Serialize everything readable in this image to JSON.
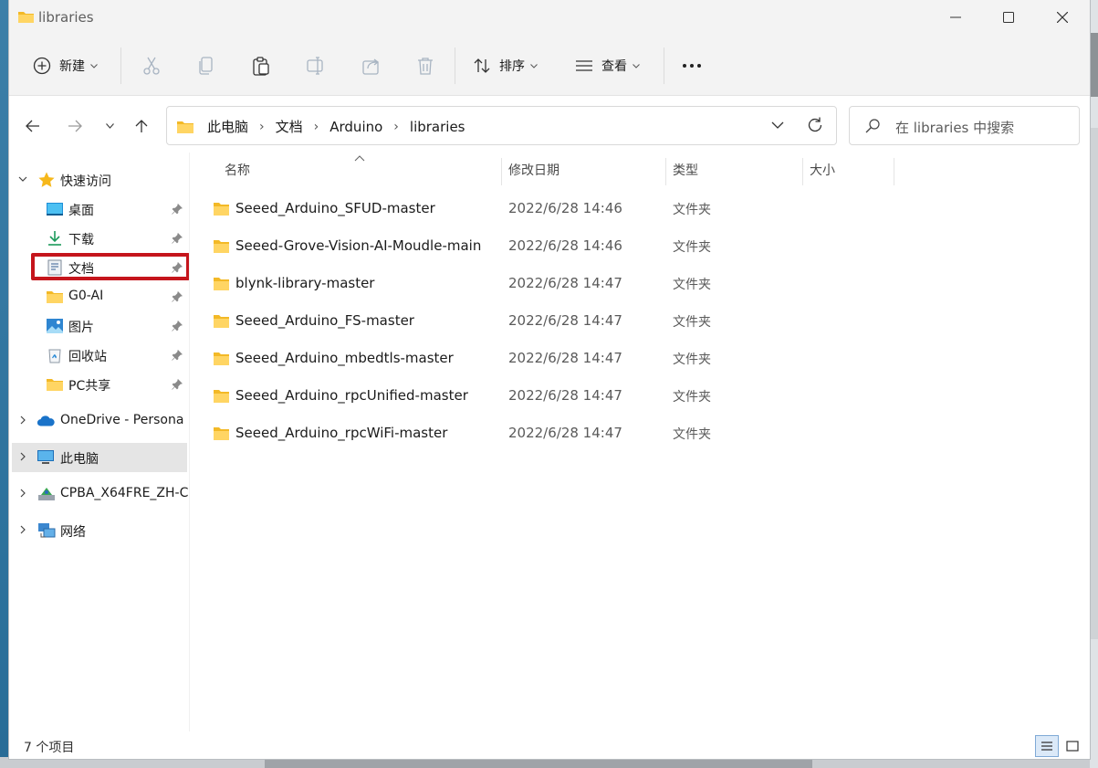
{
  "window": {
    "title": "libraries"
  },
  "toolbar": {
    "new_label": "新建",
    "sort_label": "排序",
    "view_label": "查看",
    "more_label": "···"
  },
  "address": {
    "crumbs": [
      "此电脑",
      "文档",
      "Arduino",
      "libraries"
    ]
  },
  "search": {
    "placeholder": "在 libraries 中搜索"
  },
  "sidebar": {
    "quick_access": "快速访问",
    "items": [
      {
        "label": "桌面",
        "icon": "desktop-icon"
      },
      {
        "label": "下载",
        "icon": "download-icon"
      },
      {
        "label": "文档",
        "icon": "documents-icon"
      },
      {
        "label": "G0-AI",
        "icon": "folder-icon"
      },
      {
        "label": "图片",
        "icon": "pictures-icon"
      },
      {
        "label": "回收站",
        "icon": "recycle-bin-icon"
      },
      {
        "label": "PC共享",
        "icon": "folder-icon"
      }
    ],
    "onedrive": "OneDrive - Persona",
    "this_pc": "此电脑",
    "drive": "CPBA_X64FRE_ZH-C",
    "network": "网络"
  },
  "columns": {
    "name": "名称",
    "modified": "修改日期",
    "type": "类型",
    "size": "大小"
  },
  "files": [
    {
      "name": "Seeed_Arduino_SFUD-master",
      "modified": "2022/6/28 14:46",
      "type": "文件夹"
    },
    {
      "name": "Seeed-Grove-Vision-AI-Moudle-main",
      "modified": "2022/6/28 14:46",
      "type": "文件夹"
    },
    {
      "name": "blynk-library-master",
      "modified": "2022/6/28 14:47",
      "type": "文件夹"
    },
    {
      "name": "Seeed_Arduino_FS-master",
      "modified": "2022/6/28 14:47",
      "type": "文件夹"
    },
    {
      "name": "Seeed_Arduino_mbedtls-master",
      "modified": "2022/6/28 14:47",
      "type": "文件夹"
    },
    {
      "name": "Seeed_Arduino_rpcUnified-master",
      "modified": "2022/6/28 14:47",
      "type": "文件夹"
    },
    {
      "name": "Seeed_Arduino_rpcWiFi-master",
      "modified": "2022/6/28 14:47",
      "type": "文件夹"
    }
  ],
  "status": {
    "count": "7 个项目"
  },
  "colors": {
    "highlight": "#c5151c",
    "folder": "#f7c948",
    "accent": "#0067c0"
  }
}
